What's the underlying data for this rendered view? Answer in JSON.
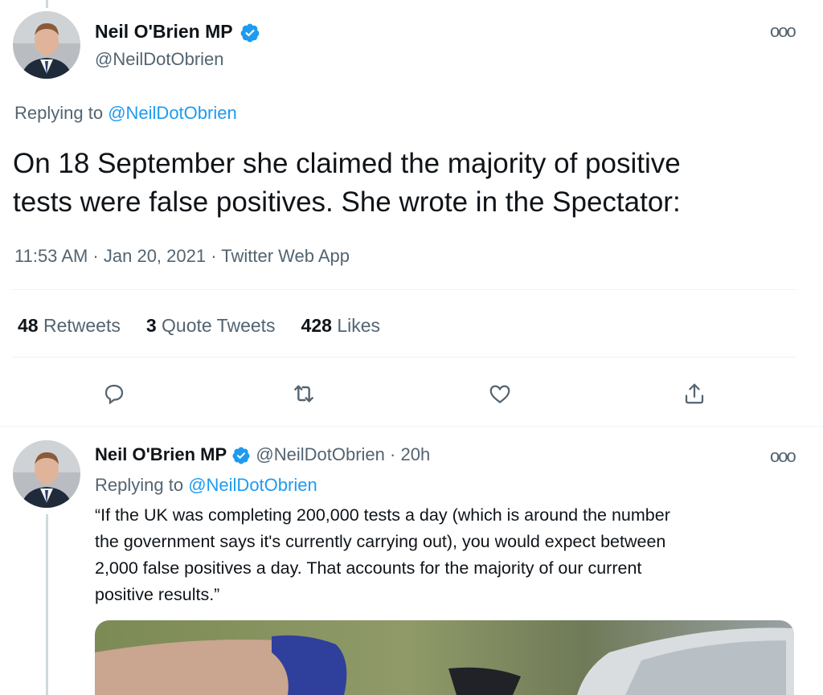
{
  "tweet": {
    "author_name": "Neil O'Brien MP",
    "author_handle": "@NeilDotObrien",
    "replying_prefix": "Replying to",
    "replying_to": "@NeilDotObrien",
    "text_line1": "On 18 September she claimed the majority of positive",
    "text_line2": "tests were false positives. She wrote in the Spectator:",
    "meta": "11:53 AM · Jan 20, 2021 · Twitter Web App",
    "retweets_count": "48",
    "retweets_label": "Retweets",
    "quotes_count": "3",
    "quotes_label": "Quote Tweets",
    "likes_count": "428",
    "likes_label": "Likes",
    "more_label": "ooo"
  },
  "reply": {
    "author_name": "Neil O'Brien MP",
    "author_handle": "@NeilDotObrien",
    "time": "· 20h",
    "replying_prefix": "Replying to",
    "replying_to": "@NeilDotObrien",
    "line1": "“If the UK was completing 200,000 tests a day (which is around the number",
    "line2": "the government says it's currently carrying out), you would expect between",
    "line3": "2,000 false positives a day. That accounts for the majority of our current",
    "line4": "positive results.”",
    "more_label": "ooo"
  },
  "icons": {
    "reply": "reply-icon",
    "retweet": "retweet-icon",
    "like": "heart-icon",
    "share": "share-icon",
    "verified": "verified-badge-icon"
  },
  "colors": {
    "accent": "#1d9bf0",
    "muted": "#536471",
    "text": "#0f1419"
  }
}
